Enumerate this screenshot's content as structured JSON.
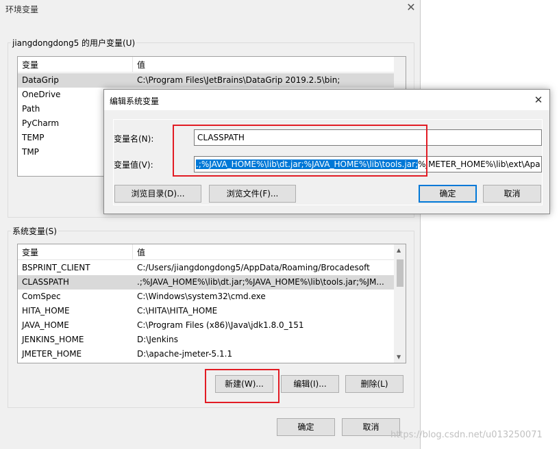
{
  "main": {
    "title": "环境变量",
    "user_group_label": "jiangdongdong5 的用户变量(U)",
    "user_table": {
      "headers": [
        "变量",
        "值"
      ],
      "rows": [
        {
          "name": "DataGrip",
          "value": "C:\\Program Files\\JetBrains\\DataGrip 2019.2.5\\bin;"
        },
        {
          "name": "OneDrive",
          "value": ""
        },
        {
          "name": "Path",
          "value": ""
        },
        {
          "name": "PyCharm",
          "value": ""
        },
        {
          "name": "TEMP",
          "value": ""
        },
        {
          "name": "TMP",
          "value": ""
        }
      ]
    },
    "system_group_label": "系统变量(S)",
    "system_table": {
      "headers": [
        "变量",
        "值"
      ],
      "rows": [
        {
          "name": "BSPRINT_CLIENT",
          "value": "C:/Users/jiangdongdong5/AppData/Roaming/Brocadesoft"
        },
        {
          "name": "CLASSPATH",
          "value": ".;%JAVA_HOME%\\lib\\dt.jar;%JAVA_HOME%\\lib\\tools.jar;%JM..."
        },
        {
          "name": "ComSpec",
          "value": "C:\\Windows\\system32\\cmd.exe"
        },
        {
          "name": "HITA_HOME",
          "value": "C:\\HITA\\HITA_HOME"
        },
        {
          "name": "JAVA_HOME",
          "value": "C:\\Program Files (x86)\\Java\\jdk1.8.0_151"
        },
        {
          "name": "JENKINS_HOME",
          "value": "D:\\Jenkins"
        },
        {
          "name": "JMETER_HOME",
          "value": "D:\\apache-jmeter-5.1.1"
        }
      ]
    },
    "buttons": {
      "new": "新建(W)...",
      "edit": "编辑(I)...",
      "delete": "删除(L)",
      "ok": "确定",
      "cancel": "取消"
    }
  },
  "edit_dialog": {
    "title": "编辑系统变量",
    "name_label": "变量名(N):",
    "name_value": "CLASSPATH",
    "value_label": "变量值(V):",
    "value_selected": ".;%JAVA_HOME%\\lib\\dt.jar;%JAVA_HOME%\\lib\\tools.jar;",
    "value_rest": "%JMETER_HOME%\\lib\\ext\\Apa",
    "buttons": {
      "browse_dir": "浏览目录(D)...",
      "browse_file": "浏览文件(F)...",
      "ok": "确定",
      "cancel": "取消"
    }
  },
  "watermark": "https://blog.csdn.net/u013250071",
  "colors": {
    "highlight": "#e21b23",
    "selection": "#0078d7"
  }
}
